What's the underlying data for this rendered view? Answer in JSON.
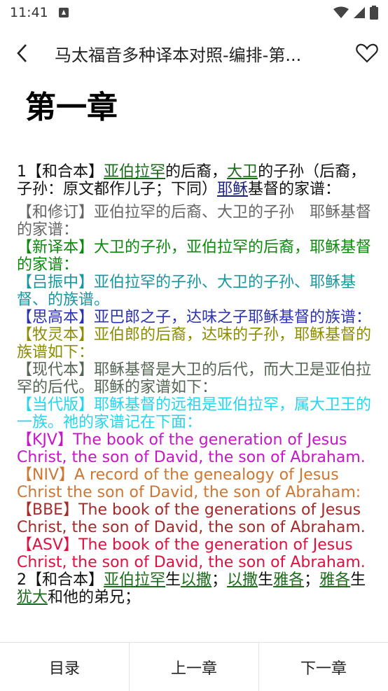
{
  "status": {
    "time": "11:41"
  },
  "appbar": {
    "title": "马太福音多种译本对照-编排-第..."
  },
  "chapter": {
    "title": "第一章"
  },
  "v1": {
    "num": "1",
    "hehe_label": "【和合本】",
    "hehe_seg": [
      "亚伯拉罕",
      "的后裔，",
      "大卫",
      "的子孙（后裔，子孙：原文都作儿子；下同）",
      "耶稣",
      "基督的家谱："
    ],
    "hexiu": "【和修订】亚伯拉罕的后裔、大卫的子孙　耶稣基督的家谱：",
    "xinyi": "【新译本】大卫的子孙，亚伯拉罕的后裔，耶稣基督的家谱：",
    "lvzhen": "【吕振中】亚伯拉罕的子孙、大卫的子孙、耶稣基督、的族谱。",
    "sigao": "【思高本】亚巴郎之子，达味之子耶稣基督的族谱：",
    "muling": "【牧灵本】亚伯郎的后裔，达味的子孙，耶稣基督的族谱如下：",
    "xiandai": "【现代本】耶稣基督是大卫的后代，而大卫是亚伯拉罕的后代。耶稣的家谱如下：",
    "dangdai": "【当代版】耶稣基督的远祖是亚伯拉罕，属大卫王的一族。祂的家谱记在下面：",
    "kjv": "【KJV】The book of the generation of Jesus Christ, the son of David, the son of Abraham.",
    "niv": "【NIV】A record of the genealogy of Jesus Christ the son of David, the son of Abraham:",
    "bbe": "【BBE】The book of the generations of Jesus Christ, the son of David, the son of Abraham.",
    "asv": "【ASV】The book of the generation of Jesus Christ, the son of David, the son of Abraham."
  },
  "v2": {
    "num": "2",
    "hehe_label": "【和合本】",
    "seg": [
      "亚伯拉罕",
      "生",
      "以撒",
      "；",
      "以撒",
      "生",
      "雅各",
      "；",
      "雅各",
      "生",
      "犹大",
      "和他的弟兄；"
    ]
  },
  "nav": {
    "toc": "目录",
    "prev": "上一章",
    "next": "下一章"
  },
  "colors": {
    "hexiu": "#666666",
    "xinyi": "#0a8a0a",
    "lvzhen": "#1697a0",
    "sigao": "#2c33b0",
    "muling": "#8c8c00",
    "xiandai": "#556655",
    "dangdai": "#22d6ee",
    "kjv": "#c617c6",
    "niv": "#cc7733",
    "bbe": "#a52a2a",
    "asv": "#e0103f",
    "link_green": "#1a6b1a",
    "link_navy": "#1a237e"
  }
}
